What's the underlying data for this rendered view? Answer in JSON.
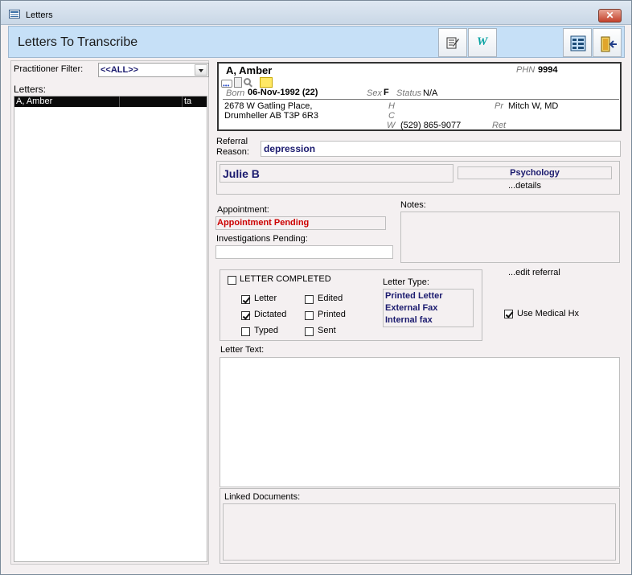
{
  "window": {
    "title": "Letters",
    "close_glyph": "✕"
  },
  "header": {
    "title": "Letters To Transcribe"
  },
  "toolbar": {
    "icons": [
      "edit-note-icon",
      "word-icon",
      "list-view-icon",
      "exit-door-icon"
    ],
    "word_glyph": "W"
  },
  "left": {
    "filter_label": "Practitioner Filter:",
    "filter_value": "<<ALL>>",
    "letters_label": "Letters:",
    "rows": [
      {
        "name": "A, Amber",
        "code": "ta"
      }
    ]
  },
  "patient": {
    "name": "A, Amber",
    "phn_label": "PHN",
    "phn": "9994",
    "born_label": "Born",
    "born": "06-Nov-1992 (22)",
    "sex_label": "Sex",
    "sex": "F",
    "status_label": "Status",
    "status": "N/A",
    "address1": "2678 W Gatling Place,",
    "address2": "Drumheller AB  T3P 6R3",
    "h_label": "H",
    "c_label": "C",
    "w_label": "W",
    "w_phone": "(529) 865-9077",
    "pr_label": "Pr",
    "practitioner": "Mitch W, MD",
    "ret_label": "Ret"
  },
  "referral": {
    "reason_label1": "Referral",
    "reason_label2": "Reason:",
    "reason": "depression",
    "referrer": "Julie B",
    "specialty": "Psychology",
    "details_link": "...details"
  },
  "appointment": {
    "label": "Appointment:",
    "value": "Appointment Pending",
    "investigations_label": "Investigations Pending:",
    "investigations_value": ""
  },
  "notes": {
    "label": "Notes:",
    "value": ""
  },
  "edit_referral_link": "...edit referral",
  "letter_status": {
    "completed_label": "LETTER COMPLETED",
    "completed": false,
    "checks": [
      {
        "label": "Letter",
        "checked": true
      },
      {
        "label": "Dictated",
        "checked": true
      },
      {
        "label": "Typed",
        "checked": false
      },
      {
        "label": "Edited",
        "checked": false
      },
      {
        "label": "Printed",
        "checked": false
      },
      {
        "label": "Sent",
        "checked": false
      }
    ],
    "type_label": "Letter Type:",
    "types": [
      "Printed Letter",
      "External Fax",
      "Internal fax"
    ]
  },
  "use_medical_hx": {
    "label": "Use Medical Hx",
    "checked": true
  },
  "letter_text": {
    "label": "Letter Text:",
    "value": ""
  },
  "linked_documents": {
    "label": "Linked Documents:"
  },
  "colors": {
    "header_bg": "#c6e0f7",
    "navy": "#1a1a6e",
    "red": "#cc0000",
    "window_bg": "#f4f0f1"
  }
}
